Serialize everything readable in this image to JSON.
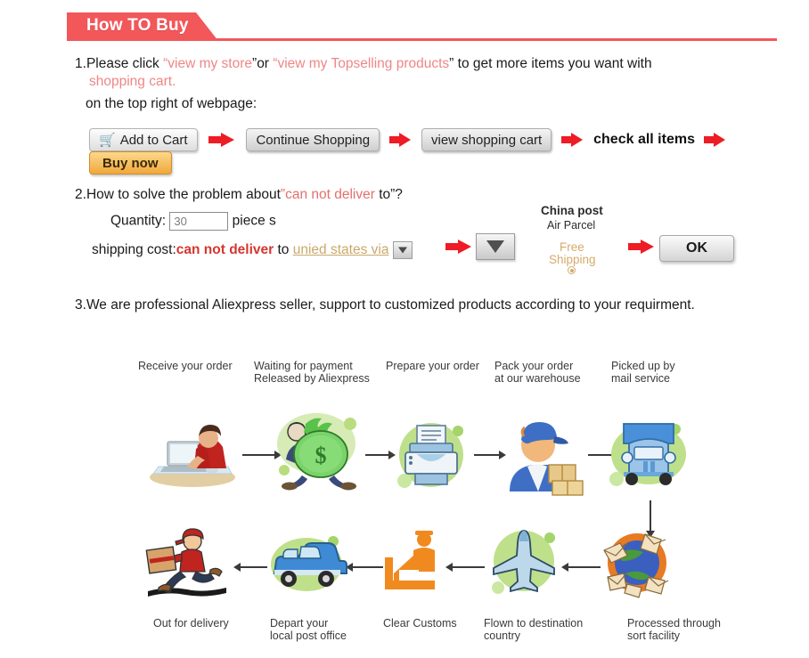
{
  "header": {
    "title": "How TO Buy"
  },
  "step1": {
    "number": "1.",
    "line1_a": "Please click ",
    "line1_q1": "“",
    "line1_link1": "view my store",
    "line1_q2": "”",
    "line1_b": "or ",
    "line1_q3": "“",
    "line1_link2": "view my Topselling products",
    "line1_q4": "”",
    "line1_c": " to get more items you want with",
    "line2_link": "shopping cart",
    "line2_end": ".",
    "line3": "on the top right of webpage:",
    "flow": [
      {
        "label": "Add to Cart",
        "kind": "button-grey",
        "icon": "shopping-cart-icon"
      },
      {
        "label": "Continue Shopping",
        "kind": "button-grey"
      },
      {
        "label": "view shopping cart",
        "kind": "button-grey"
      },
      {
        "label": "check all items",
        "kind": "text"
      },
      {
        "label": "Buy now",
        "kind": "button-orange"
      }
    ]
  },
  "step2": {
    "number": "2.",
    "heading_a": "How to solve the problem about",
    "heading_q1": "”",
    "heading_red": "can not deliver",
    "heading_b": " to",
    "heading_q2": "”?",
    "quantity_label": "Quantity:",
    "quantity_value": "30",
    "quantity_unit": "piece s",
    "shipping_label": "shipping cost:",
    "shipping_red": "can not deliver",
    "shipping_to": " to ",
    "shipping_country": "unied states via",
    "carrier_name": "China post",
    "carrier_service": "Air Parcel",
    "carrier_price_line1": "Free",
    "carrier_price_line2": "Shipping",
    "ok_label": "OK"
  },
  "step3": {
    "number": "3.",
    "text": "We are professional Aliexpress seller, support to customized products according to your requirment."
  },
  "flowchart": {
    "top_row": [
      {
        "label": "Receive your order",
        "icon": "person-at-computer-icon"
      },
      {
        "label": "Waiting for payment\nReleased by Aliexpress",
        "icon": "money-bag-icon"
      },
      {
        "label": "Prepare your order",
        "icon": "printer-icon"
      },
      {
        "label": "Pack your order\nat our warehouse",
        "icon": "worker-with-boxes-icon"
      },
      {
        "label": "Picked up by\nmail service",
        "icon": "delivery-truck-icon"
      }
    ],
    "bottom_row": [
      {
        "label": "Out for delivery",
        "icon": "running-courier-icon"
      },
      {
        "label": "Depart your\nlocal post office",
        "icon": "delivery-van-icon"
      },
      {
        "label": "Clear Customs",
        "icon": "customs-officer-icon"
      },
      {
        "label": "Flown to destination\ncountry",
        "icon": "airplane-icon"
      },
      {
        "label": "Processed through\nsort facility",
        "icon": "mail-sorting-globe-icon"
      }
    ]
  },
  "colors": {
    "banner": "#f2575a",
    "link_red": "#ef8686",
    "strong_red": "#d6362f",
    "arrow_red": "#ee1c24",
    "buy_now": "#f0a83c",
    "blob_green": "#b9dd7e",
    "tan": "#c9a96a"
  }
}
